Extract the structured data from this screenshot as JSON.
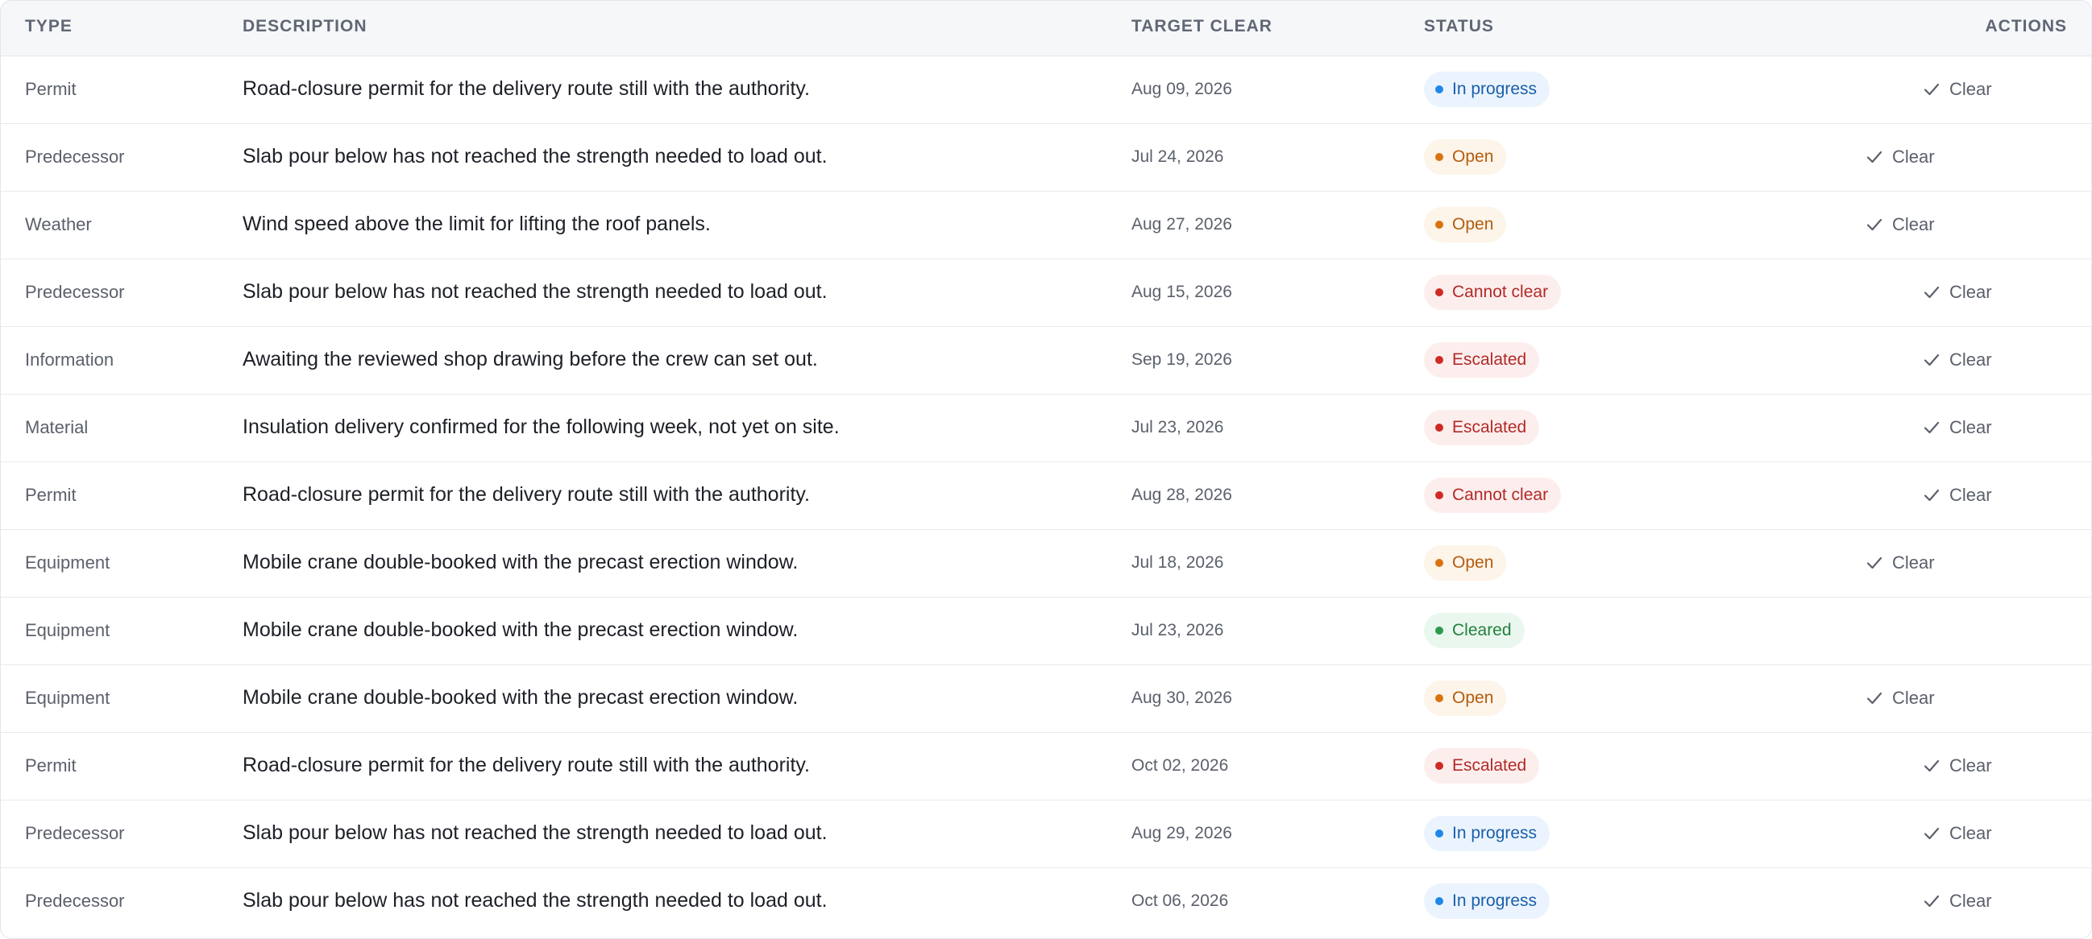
{
  "table": {
    "headers": {
      "type": "TYPE",
      "description": "DESCRIPTION",
      "target_clear": "TARGET CLEAR",
      "status": "STATUS",
      "actions": "ACTIONS"
    },
    "action_label": "Clear",
    "rows": [
      {
        "type": "Permit",
        "description": "Road-closure permit for the delivery route still with the authority.",
        "target": "Aug 09, 2026",
        "status": "In progress",
        "status_key": "inprogress",
        "action": "Clear"
      },
      {
        "type": "Predecessor",
        "description": "Slab pour below has not reached the strength needed to load out.",
        "target": "Jul 24, 2026",
        "status": "Open",
        "status_key": "open",
        "action": "Clear"
      },
      {
        "type": "Weather",
        "description": "Wind speed above the limit for lifting the roof panels.",
        "target": "Aug 27, 2026",
        "status": "Open",
        "status_key": "open",
        "action": "Clear"
      },
      {
        "type": "Predecessor",
        "description": "Slab pour below has not reached the strength needed to load out.",
        "target": "Aug 15, 2026",
        "status": "Cannot clear",
        "status_key": "cannot",
        "action": "Clear"
      },
      {
        "type": "Information",
        "description": "Awaiting the reviewed shop drawing before the crew can set out.",
        "target": "Sep 19, 2026",
        "status": "Escalated",
        "status_key": "escalated",
        "action": "Clear"
      },
      {
        "type": "Material",
        "description": "Insulation delivery confirmed for the following week, not yet on site.",
        "target": "Jul 23, 2026",
        "status": "Escalated",
        "status_key": "escalated",
        "action": "Clear"
      },
      {
        "type": "Permit",
        "description": "Road-closure permit for the delivery route still with the authority.",
        "target": "Aug 28, 2026",
        "status": "Cannot clear",
        "status_key": "cannot",
        "action": "Clear"
      },
      {
        "type": "Equipment",
        "description": "Mobile crane double-booked with the precast erection window.",
        "target": "Jul 18, 2026",
        "status": "Open",
        "status_key": "open",
        "action": "Clear"
      },
      {
        "type": "Equipment",
        "description": "Mobile crane double-booked with the precast erection window.",
        "target": "Jul 23, 2026",
        "status": "Cleared",
        "status_key": "cleared",
        "action": ""
      },
      {
        "type": "Equipment",
        "description": "Mobile crane double-booked with the precast erection window.",
        "target": "Aug 30, 2026",
        "status": "Open",
        "status_key": "open",
        "action": "Clear"
      },
      {
        "type": "Permit",
        "description": "Road-closure permit for the delivery route still with the authority.",
        "target": "Oct 02, 2026",
        "status": "Escalated",
        "status_key": "escalated",
        "action": "Clear"
      },
      {
        "type": "Predecessor",
        "description": "Slab pour below has not reached the strength needed to load out.",
        "target": "Aug 29, 2026",
        "status": "In progress",
        "status_key": "inprogress",
        "action": "Clear"
      },
      {
        "type": "Predecessor",
        "description": "Slab pour below has not reached the strength needed to load out.",
        "target": "Oct 06, 2026",
        "status": "In progress",
        "status_key": "inprogress",
        "action": "Clear"
      }
    ]
  },
  "icons": {
    "action_icon": "checkmark-icon",
    "status_icon": "status-dot-icon"
  },
  "colors": {
    "inprogress": "#1f87e8",
    "open": "#d9730f",
    "cannot_clear": "#cf2a24",
    "escalated": "#cf2a24",
    "cleared": "#2c9a4d"
  }
}
